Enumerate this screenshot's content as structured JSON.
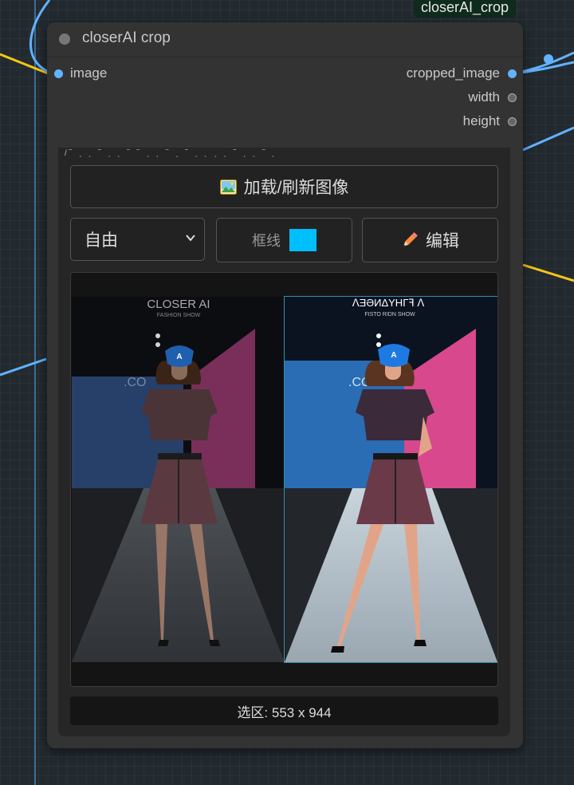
{
  "node": {
    "title": "closerAI crop",
    "label": "closerAI_crop",
    "inputs": [
      "image"
    ],
    "outputs": [
      "cropped_image",
      "width",
      "height"
    ]
  },
  "widgets": {
    "load_button": "加载/刷新图像",
    "ratio_mode": "自由",
    "frame_line_label": "框线",
    "frame_line_color": "#00bfff",
    "edit_button": "编辑",
    "selection_info": "选区: 553 x 944"
  },
  "preview": {
    "left": {
      "brand": "CLOSER AI",
      "subtitle": "FASHION SHOW",
      "mask_letter": "A"
    },
    "right": {
      "brand": "ᐱƎƏИΔYHГꟻ ᐱ",
      "subtitle": "FISTO RIDN SHOW",
      "mask_letter": "A"
    }
  },
  "icons": {
    "load": "image-icon",
    "edit": "pencil-icon",
    "dropdown": "chevron-down-icon"
  },
  "colors": {
    "wire_blue": "#62b2ff",
    "wire_yellow": "#f5c518",
    "node_bg": "#333333"
  }
}
